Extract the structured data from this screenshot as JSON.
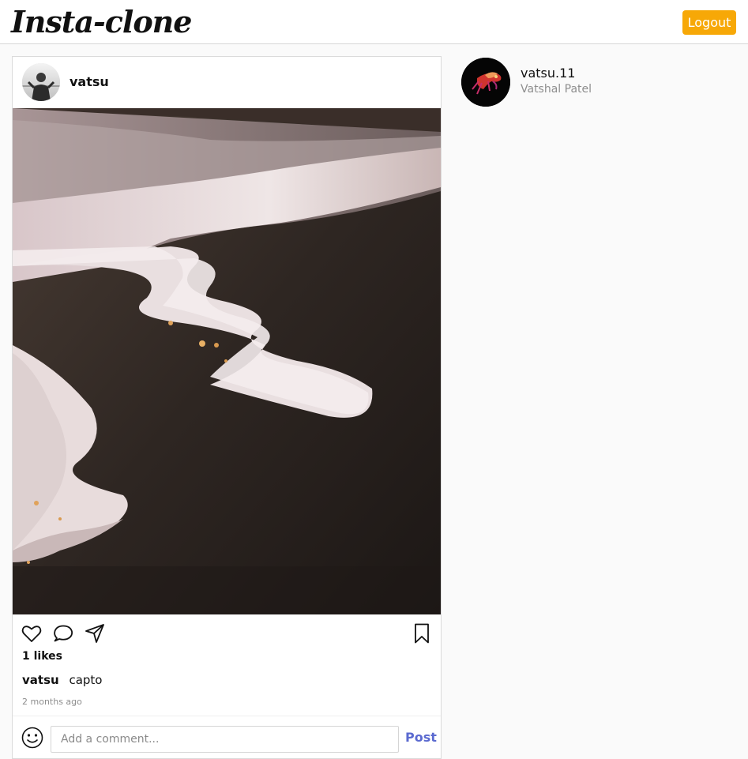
{
  "header": {
    "logo_text": "Insta-clone",
    "logout_label": "Logout",
    "logout_color": "#f7a807"
  },
  "post": {
    "username": "vatsu",
    "likes_text": "1 likes",
    "caption_user": "vatsu",
    "caption_text": "capto",
    "timestamp": "2 months ago",
    "comment_placeholder": "Add a comment...",
    "post_button_label": "Post",
    "post_button_color": "#5b6ad0",
    "icons": [
      "heart-icon",
      "comment-icon",
      "share-icon",
      "bookmark-icon",
      "emoji-icon"
    ]
  },
  "profile": {
    "username": "vatsu.11",
    "full_name": "Vatshal Patel"
  }
}
